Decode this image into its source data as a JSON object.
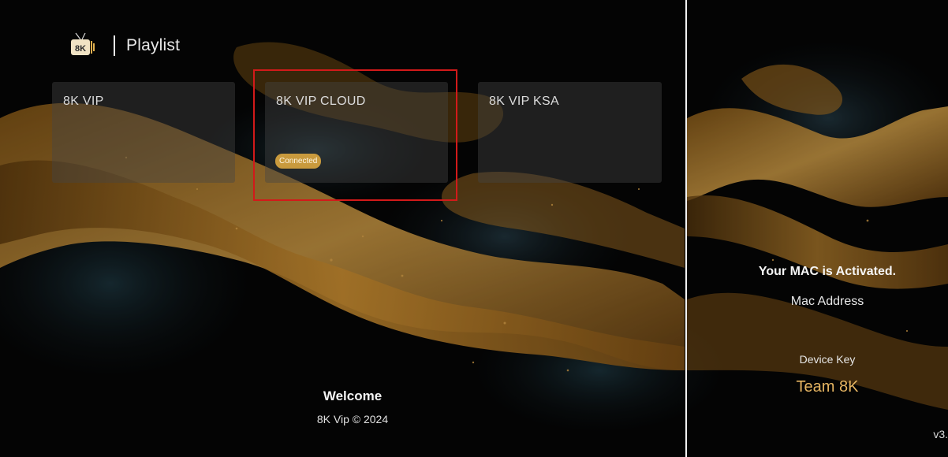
{
  "header": {
    "logo_text": "8K",
    "title": "Playlist"
  },
  "playlists": [
    {
      "name": "8K VIP",
      "status": ""
    },
    {
      "name": "8K VIP CLOUD",
      "status": "Connected"
    },
    {
      "name": "8K VIP KSA",
      "status": ""
    }
  ],
  "footer": {
    "welcome": "Welcome",
    "copyright": "8K Vip © 2024"
  },
  "device": {
    "mac_status": "Your MAC is Activated.",
    "mac_label": "Mac Address",
    "key_label": "Device Key",
    "key_value": "Team 8K",
    "version": "v3."
  },
  "colors": {
    "accent": "#e6b562",
    "badge": "#c99a3d",
    "focus_border": "#d21a1a",
    "background": "#050505"
  }
}
